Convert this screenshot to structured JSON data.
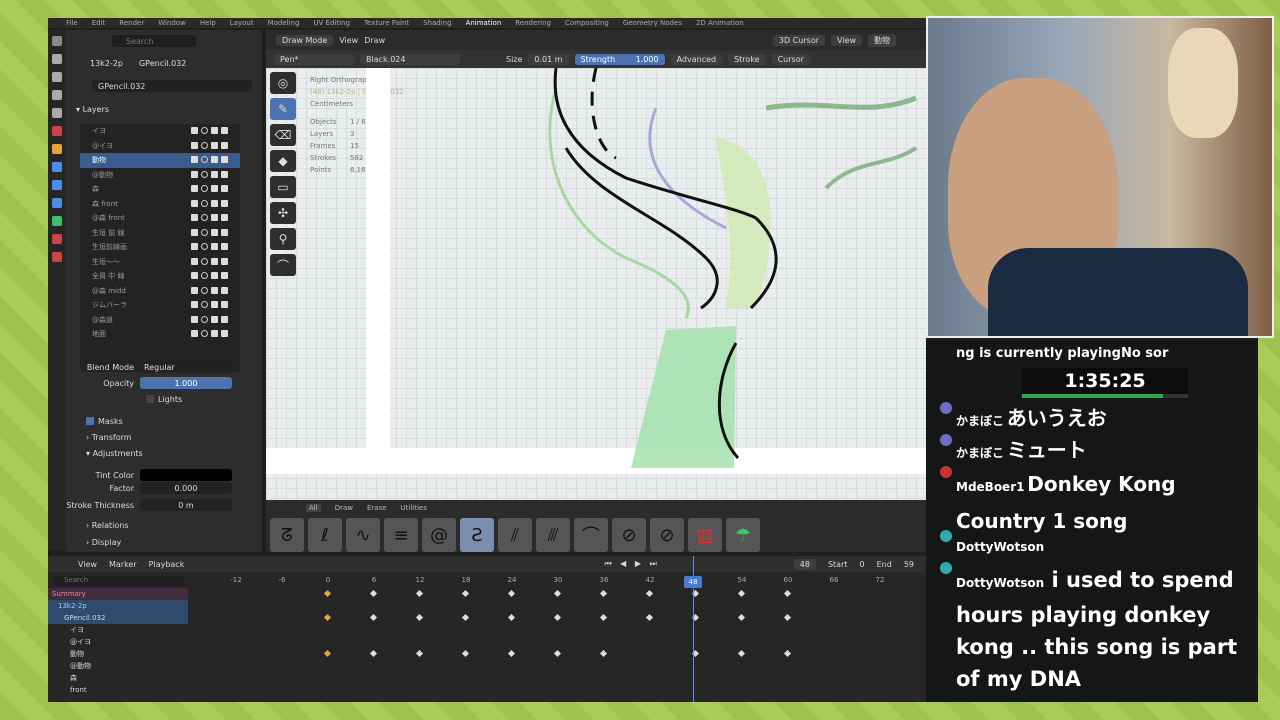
{
  "topmenu": [
    "File",
    "Edit",
    "Render",
    "Window",
    "Help",
    "Layout",
    "Modeling",
    "UV Editing",
    "Texture Paint",
    "Shading",
    "Animation",
    "Rendering",
    "Compositing",
    "Geometry Nodes",
    "2D Animation"
  ],
  "props": {
    "search_placeholder": "Search",
    "breadcrumb_scene": "13k2-2p",
    "breadcrumb_object": "GPencil.032",
    "data_name": "GPencil.032",
    "layers_header": "Layers",
    "layers": [
      {
        "name": "イヨ",
        "active": false
      },
      {
        "name": "@イヨ",
        "active": false
      },
      {
        "name": "動物",
        "active": true
      },
      {
        "name": "@動物",
        "active": false
      },
      {
        "name": "森",
        "active": false
      },
      {
        "name": "森 front",
        "active": false
      },
      {
        "name": "@森 front",
        "active": false
      },
      {
        "name": "生垣 前 線",
        "active": false
      },
      {
        "name": "生垣前線画",
        "active": false
      },
      {
        "name": "生垣〜〜",
        "active": false
      },
      {
        "name": "全員 中 線",
        "active": false
      },
      {
        "name": "@森 midd",
        "active": false
      },
      {
        "name": "ジムバーラ",
        "active": false
      },
      {
        "name": "@森道",
        "active": false
      },
      {
        "name": "地面",
        "active": false
      }
    ],
    "blend_mode_label": "Blend Mode",
    "blend_mode_value": "Regular",
    "opacity_label": "Opacity",
    "opacity_value": "1.000",
    "lights_label": "Lights",
    "masks_label": "Masks",
    "transform_label": "Transform",
    "adjustments_label": "Adjustments",
    "tint_color_label": "Tint Color",
    "factor_label": "Factor",
    "factor_value": "0.000",
    "stroke_thickness_label": "Stroke Thickness",
    "stroke_thickness_value": "0 m",
    "relations_label": "Relations",
    "display_label": "Display"
  },
  "viewport": {
    "mode": "Draw Mode",
    "view": "View",
    "draw": "Draw",
    "cursor": "3D Cursor",
    "view2": "View",
    "layer_dropdown": "動物",
    "tool": "Pen*",
    "material": "Black.024",
    "size_label": "Size",
    "size_value": "0.01 m",
    "strength_label": "Strength",
    "strength_value": "1.000",
    "advanced": "Advanced",
    "stroke": "Stroke",
    "cursor2": "Cursor",
    "info_view": "Right Orthographic",
    "info_obj": "(48) 13k2-2p | GPencil.032",
    "info_units": "Centimeters",
    "stats": [
      {
        "label": "Objects",
        "value": "1 / 6"
      },
      {
        "label": "Layers",
        "value": "3"
      },
      {
        "label": "Frames",
        "value": "15"
      },
      {
        "label": "Strokes",
        "value": "582"
      },
      {
        "label": "Points",
        "value": "6,166"
      }
    ]
  },
  "brushbar": {
    "tabs": [
      "All",
      "Draw",
      "Erase",
      "Utilities"
    ]
  },
  "timeline": {
    "menus": [
      "View",
      "Marker",
      "Playback"
    ],
    "search_placeholder": "Search",
    "frame_ticks": [
      "-12",
      "-6",
      "0",
      "6",
      "12",
      "18",
      "24",
      "30",
      "36",
      "42",
      "48",
      "54",
      "60",
      "66",
      "72"
    ],
    "current_frame": "48",
    "current_frame_box": "48",
    "start_label": "Start",
    "start_value": "0",
    "end_label": "End",
    "end_value": "59",
    "channels": [
      "Summary",
      "13k2-2p",
      "GPencil.032",
      "イヨ",
      "@イヨ",
      "動物",
      "@動物",
      "森",
      "front"
    ]
  },
  "stream": {
    "now_playing": "ng is currently playingNo sor",
    "timer": "1:35:25",
    "messages": [
      {
        "user": "かまぼこ",
        "text": "あいうえお"
      },
      {
        "user": "かまぼこ",
        "text": "ミュート"
      },
      {
        "user": "MdeBoer1",
        "text": "Donkey Kong Country 1 song"
      },
      {
        "user": "DottyWotson",
        "text": ""
      },
      {
        "user": "DottyWotson",
        "text": "i used to spend hours playing donkey kong .. this song is part of my DNA"
      }
    ]
  }
}
